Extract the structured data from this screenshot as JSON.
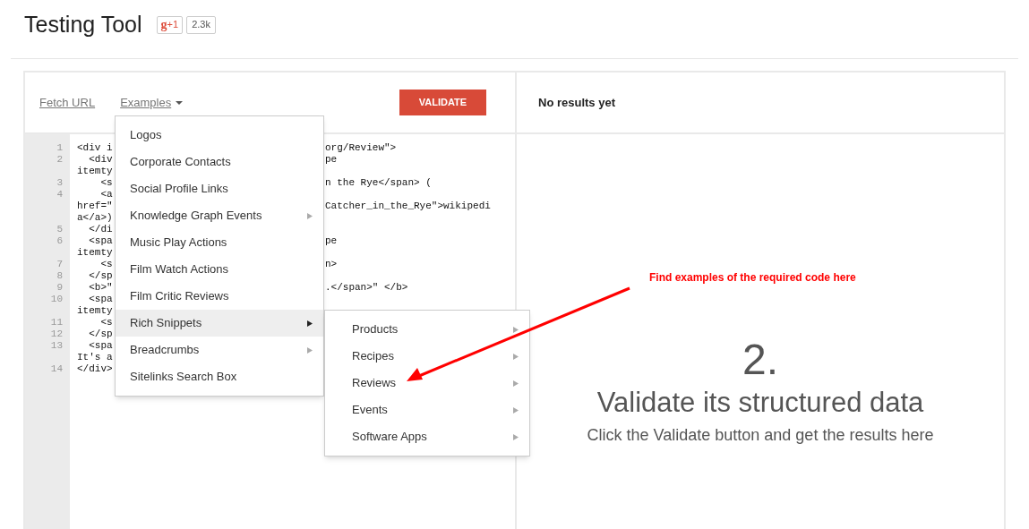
{
  "header": {
    "title": "Testing Tool",
    "plus_one": {
      "logo": "g",
      "label": "+1",
      "count": "2.3k"
    }
  },
  "toolbar": {
    "links": [
      {
        "label": "Fetch URL",
        "dropdown": false
      },
      {
        "label": "Examples",
        "dropdown": true
      }
    ],
    "validate_button": "VALIDATE"
  },
  "results": {
    "status": "No results yet",
    "step": "2.",
    "heading": "Validate its structured data",
    "hint": "Click the Validate button and get the results here"
  },
  "code_lines": [
    {
      "number": "1",
      "left": "<div i",
      "right": "org/Review\">"
    },
    {
      "number": "2",
      "left": "  <div",
      "right": "pe"
    },
    {
      "left": "itemty"
    },
    {
      "number": "3",
      "left": "    <s",
      "right": "n the Rye</span> ("
    },
    {
      "number": "4",
      "left": "    <a"
    },
    {
      "left": "href=\"",
      "right": "Catcher_in_the_Rye\">wikipedi"
    },
    {
      "left": "a</a>)"
    },
    {
      "number": "5",
      "left": "  </di"
    },
    {
      "number": "6",
      "left": "  <spa",
      "right": "pe"
    },
    {
      "left": "itemty"
    },
    {
      "number": "7",
      "left": "    <s",
      "right": "n>"
    },
    {
      "number": "8",
      "left": "  </sp"
    },
    {
      "number": "9",
      "left": "  <b>\"",
      "right": ".</span>\" </b>"
    },
    {
      "number": "10",
      "left": "  <spa"
    },
    {
      "left": "itemty"
    },
    {
      "number": "11",
      "left": "    <s"
    },
    {
      "number": "12",
      "left": "  </sp"
    },
    {
      "number": "13",
      "left": "  <spa"
    },
    {
      "left": "It's a"
    },
    {
      "number": "14",
      "left": "</div>"
    }
  ],
  "examples_menu": [
    {
      "label": "Logos",
      "has_submenu": false,
      "selected": false
    },
    {
      "label": "Corporate Contacts",
      "has_submenu": false,
      "selected": false
    },
    {
      "label": "Social Profile Links",
      "has_submenu": false,
      "selected": false
    },
    {
      "label": "Knowledge Graph Events",
      "has_submenu": true,
      "selected": false
    },
    {
      "label": "Music Play Actions",
      "has_submenu": false,
      "selected": false
    },
    {
      "label": "Film Watch Actions",
      "has_submenu": false,
      "selected": false
    },
    {
      "label": "Film Critic Reviews",
      "has_submenu": false,
      "selected": false
    },
    {
      "label": "Rich Snippets",
      "has_submenu": true,
      "selected": true
    },
    {
      "label": "Breadcrumbs",
      "has_submenu": true,
      "selected": false
    },
    {
      "label": "Sitelinks Search Box",
      "has_submenu": false,
      "selected": false
    }
  ],
  "submenu": [
    {
      "label": "Products",
      "has_submenu": true
    },
    {
      "label": "Recipes",
      "has_submenu": true
    },
    {
      "label": "Reviews",
      "has_submenu": true
    },
    {
      "label": "Events",
      "has_submenu": true
    },
    {
      "label": "Software Apps",
      "has_submenu": true
    }
  ],
  "annotation": {
    "text": "Find examples of the required code here"
  }
}
